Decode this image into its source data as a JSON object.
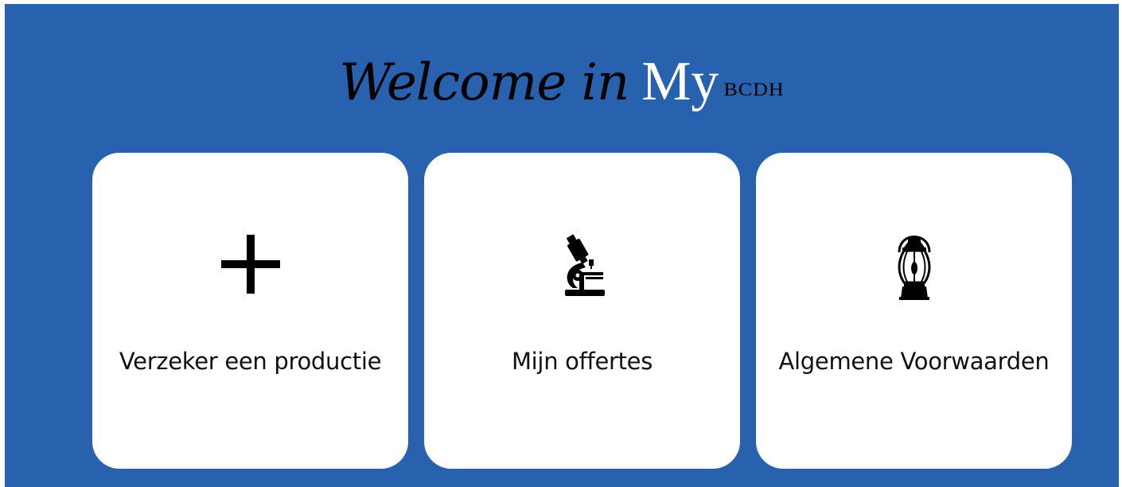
{
  "header": {
    "welcome_text": "Welcome in",
    "my_text": "My",
    "brand_text": "BCDH"
  },
  "cards": [
    {
      "label": "Verzeker een productie",
      "icon": "plus-icon"
    },
    {
      "label": "Mijn offertes",
      "icon": "microscope-icon"
    },
    {
      "label": "Algemene Voorwaarden",
      "icon": "lantern-icon"
    }
  ],
  "colors": {
    "background": "#2862ae",
    "card": "#ffffff",
    "title_dark": "#000000",
    "title_light": "#ffffff"
  }
}
